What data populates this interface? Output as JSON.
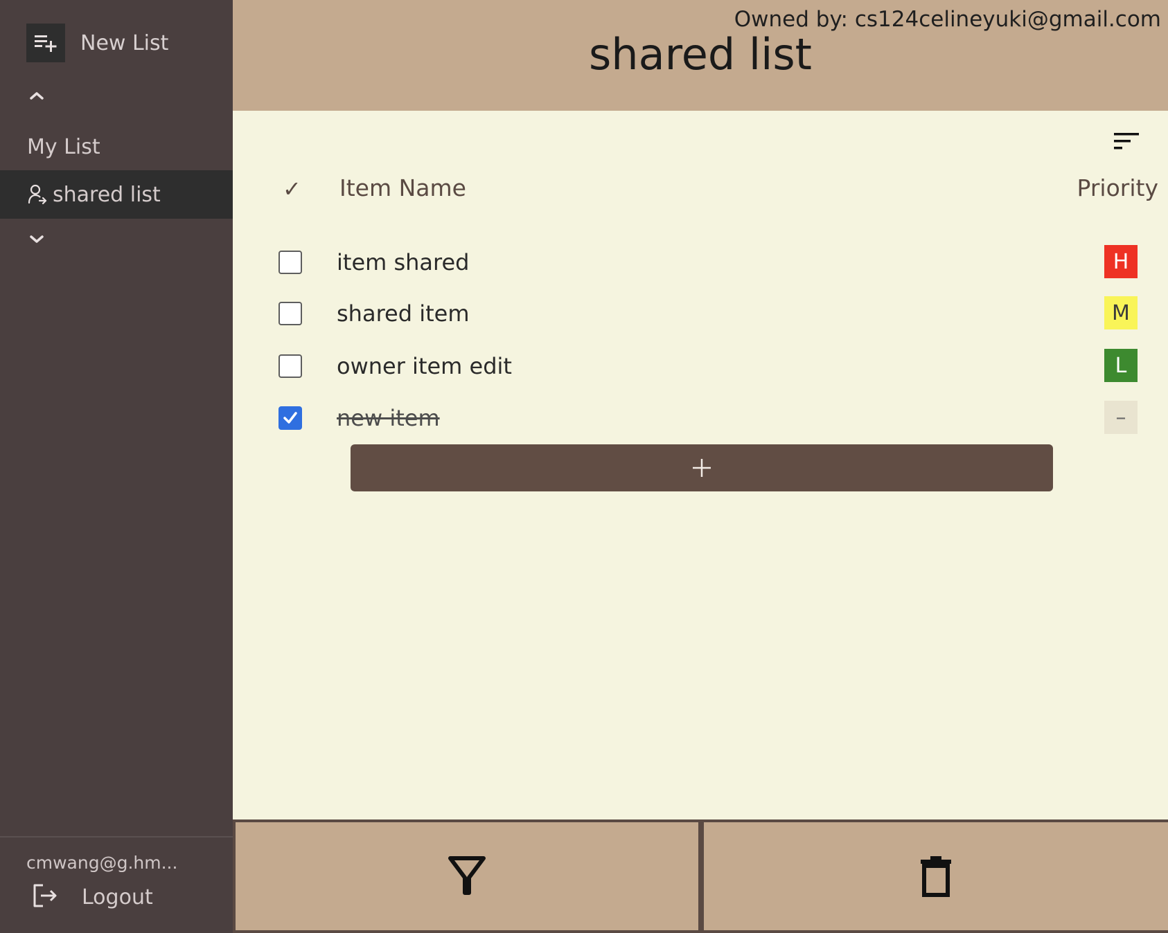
{
  "sidebar": {
    "new_list_label": "New List",
    "icons": {
      "new_list": "playlist-add-icon",
      "collapse": "chevron-up-icon",
      "expand": "chevron-down-icon",
      "shared": "shared-user-icon",
      "logout": "logout-icon"
    },
    "lists": [
      {
        "label": "My List",
        "shared": false,
        "selected": false
      },
      {
        "label": "shared list",
        "shared": true,
        "selected": true
      }
    ],
    "user_email": "cmwang@g.hm...",
    "logout_label": "Logout"
  },
  "header": {
    "owned_by": "Owned by: cs124celineyuki@gmail.com",
    "title": "shared list"
  },
  "table": {
    "check_header": "✓",
    "name_header": "Item Name",
    "priority_header": "Priority",
    "sort_icon": "sort-icon",
    "items": [
      {
        "name": "item shared",
        "checked": false,
        "priority": "H",
        "priority_color": "#ee3224",
        "priority_text_color": "#ffffff"
      },
      {
        "name": "shared item",
        "checked": false,
        "priority": "M",
        "priority_color": "#f9f458",
        "priority_text_color": "#3a3a3a"
      },
      {
        "name": "owner item edit",
        "checked": false,
        "priority": "L",
        "priority_color": "#3d8a2f",
        "priority_text_color": "#ffffff"
      },
      {
        "name": "new item",
        "checked": true,
        "priority": "–",
        "priority_color": "#e9e4d0",
        "priority_text_color": "#6a6a6a"
      }
    ],
    "add_button_icon": "plus-icon"
  },
  "toolbar": {
    "filter_icon": "filter-icon",
    "delete_icon": "trash-icon"
  },
  "colors": {
    "sidebar_bg": "#4a3f3f",
    "header_bg": "#c4aa8f",
    "main_bg": "#f5f4df",
    "accent_brown": "#614d44",
    "checkbox_checked": "#2f6fe0"
  }
}
